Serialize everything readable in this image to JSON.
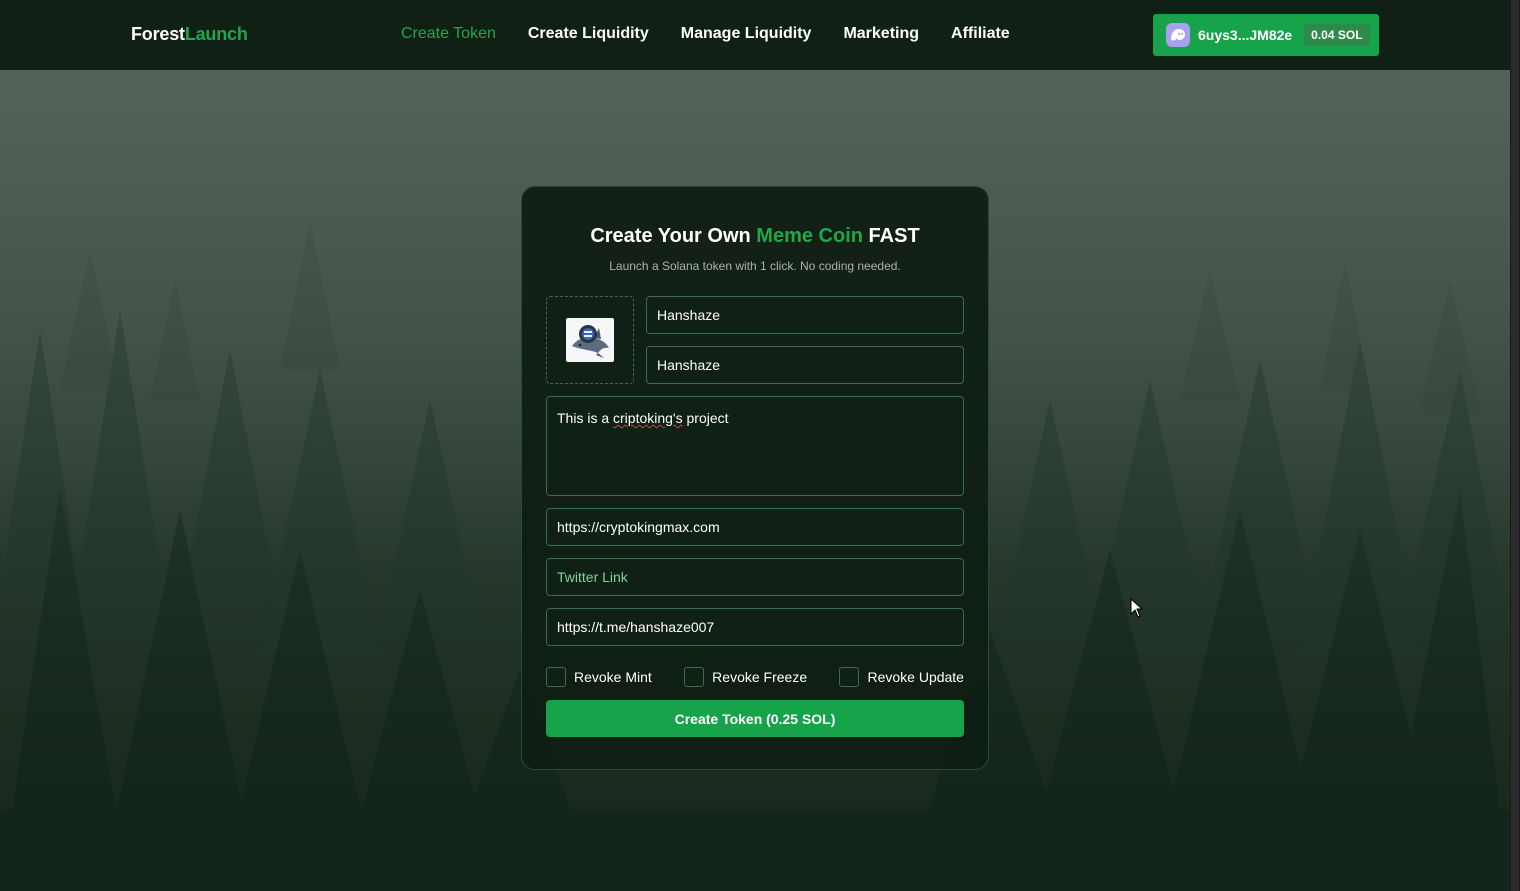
{
  "header": {
    "logo_part1": "Forest",
    "logo_part2": "Launch",
    "nav": [
      {
        "label": "Create Token"
      },
      {
        "label": "Create Liquidity"
      },
      {
        "label": "Manage Liquidity"
      },
      {
        "label": "Marketing"
      },
      {
        "label": "Affiliate"
      }
    ],
    "wallet": {
      "icon": "phantom-ghost-icon",
      "address": "6uys3...JM82e",
      "balance": "0.04 SOL"
    }
  },
  "form": {
    "title_part1": "Create Your Own",
    "title_part2": "Meme Coin",
    "title_part3": "FAST",
    "subtitle": "Launch a Solana token with 1 click. No coding needed.",
    "logo_icon": "token-logo-image",
    "token_name": "Hanshaze",
    "token_symbol": "Hanshaze",
    "description_part1": "This is a ",
    "description_part2": "criptoking's",
    "description_part3": " project",
    "website": "https://cryptokingmax.com",
    "twitter_placeholder": "Twitter Link",
    "telegram": "https://t.me/hanshaze007",
    "checkboxes": [
      {
        "label": "Revoke Mint",
        "checked": false
      },
      {
        "label": "Revoke Freeze",
        "checked": false
      },
      {
        "label": "Revoke Update",
        "checked": false
      }
    ],
    "submit_label": "Create Token (0.25 SOL)"
  },
  "colors": {
    "accent": "#16a34a",
    "accent_text": "#22a64c",
    "navbar": "#102015",
    "card": "#101e14"
  }
}
